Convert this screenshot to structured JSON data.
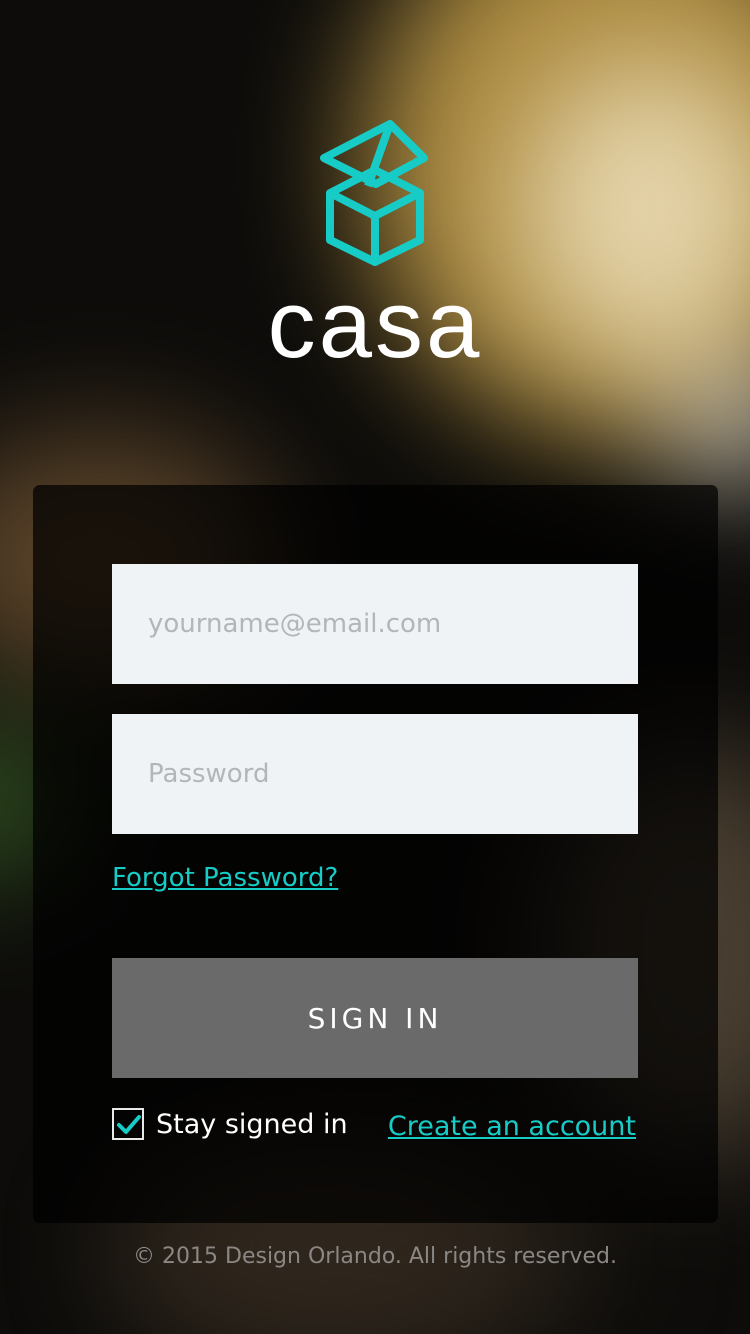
{
  "brand": {
    "name": "casa",
    "logo_icon": "open-box-icon",
    "accent_color": "#17ccc7"
  },
  "form": {
    "email_placeholder": "yourname@email.com",
    "password_placeholder": "Password",
    "forgot_label": "Forgot Password?",
    "signin_label": "SIGN IN",
    "stay_signed_in_label": "Stay signed in",
    "stay_signed_in_checked": true,
    "create_account_label": "Create an account"
  },
  "footer": {
    "copyright": "© 2015 Design Orlando. All rights reserved."
  }
}
